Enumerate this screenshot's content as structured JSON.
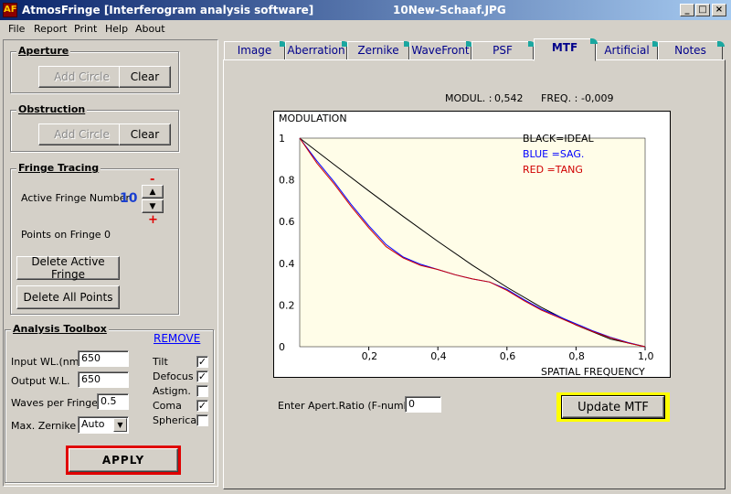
{
  "window": {
    "app_title": "AtmosFringe  [Interferogram analysis software]",
    "file_name": "10New-Schaaf.JPG",
    "icon_glyph": "AF",
    "controls": {
      "minimize": "_",
      "maximize": "□",
      "close": "×"
    }
  },
  "menu": [
    "File",
    "Report",
    "Print",
    "Help",
    "About"
  ],
  "aperture": {
    "title": "Aperture",
    "add_circle": "Add Circle",
    "clear": "Clear"
  },
  "obstruction": {
    "title": "Obstruction",
    "add_circle": "Add Circle",
    "clear": "Clear"
  },
  "fringe_tracing": {
    "title": "Fringe Tracing",
    "active_label": "Active Fringe Number",
    "active_value": "10",
    "minus": "-",
    "plus": "+",
    "points_label": "Points on  Fringe",
    "points_value": "0",
    "delete_active": "Delete Active Fringe",
    "delete_all": "Delete  All  Points"
  },
  "toolbox": {
    "title": "Analysis Toolbox",
    "remove": "REMOVE",
    "input_wl_label": "Input WL.(nm)",
    "input_wl_value": "650",
    "output_wl_label": "Output W.L.",
    "output_wl_value": "650",
    "waves_label": "Waves per Fringe",
    "waves_value": "0.5",
    "max_zernike_label": "Max. Zernike",
    "max_zernike_value": "Auto",
    "checks": [
      {
        "label": "Tilt",
        "checked": true
      },
      {
        "label": "Defocus",
        "checked": true
      },
      {
        "label": "Astigm.",
        "checked": false
      },
      {
        "label": "Coma",
        "checked": true
      },
      {
        "label": "Spherical",
        "checked": false
      }
    ],
    "apply": "APPLY"
  },
  "tabs": [
    "Image",
    "Aberration",
    "Zernike",
    "WaveFront",
    "PSF",
    "MTF",
    "Artificial",
    "Notes"
  ],
  "active_tab": "MTF",
  "mtf": {
    "modul_label": "MODUL. :",
    "modul_value": "0,542",
    "freq_label": "FREQ. :",
    "freq_value": "-0,009",
    "f_number_label": "Enter Apert.Ratio (F-number)",
    "f_number_value": "0",
    "update_button": "Update MTF"
  },
  "chart_data": {
    "type": "line",
    "ylabel": "MODULATION",
    "xlabel": "SPATIAL FREQUENCY",
    "xlim": [
      0,
      1
    ],
    "ylim": [
      0,
      1
    ],
    "x_ticks": [
      "0,2",
      "0,4",
      "0,6",
      "0,8",
      "1,0"
    ],
    "y_ticks": [
      "0",
      "0.2",
      "0.4",
      "0.6",
      "0.8",
      "1"
    ],
    "plot_background": "#fffde8",
    "legend": [
      "BLACK=IDEAL",
      "BLUE  =SAG.",
      "RED    =TANG"
    ],
    "series": [
      {
        "name": "IDEAL",
        "color": "#000000",
        "x": [
          0,
          0.1,
          0.2,
          0.3,
          0.4,
          0.5,
          0.6,
          0.7,
          0.8,
          0.9,
          1.0
        ],
        "y": [
          1.0,
          0.873,
          0.747,
          0.624,
          0.505,
          0.391,
          0.285,
          0.188,
          0.104,
          0.037,
          0.0
        ]
      },
      {
        "name": "SAG.",
        "color": "#0000ff",
        "x": [
          0,
          0.05,
          0.1,
          0.15,
          0.2,
          0.25,
          0.3,
          0.35,
          0.4,
          0.45,
          0.5,
          0.55,
          0.6,
          0.65,
          0.7,
          0.75,
          0.8,
          0.85,
          0.9,
          0.95,
          1.0
        ],
        "y": [
          1.0,
          0.89,
          0.79,
          0.68,
          0.58,
          0.49,
          0.43,
          0.395,
          0.37,
          0.345,
          0.325,
          0.31,
          0.275,
          0.225,
          0.18,
          0.145,
          0.11,
          0.075,
          0.045,
          0.02,
          0.0
        ]
      },
      {
        "name": "TANG",
        "color": "#d00000",
        "x": [
          0,
          0.05,
          0.1,
          0.15,
          0.2,
          0.25,
          0.3,
          0.35,
          0.4,
          0.45,
          0.5,
          0.55,
          0.6,
          0.65,
          0.7,
          0.75,
          0.8,
          0.85,
          0.9,
          0.95,
          1.0
        ],
        "y": [
          1.0,
          0.88,
          0.78,
          0.67,
          0.57,
          0.48,
          0.425,
          0.39,
          0.37,
          0.345,
          0.325,
          0.31,
          0.27,
          0.22,
          0.175,
          0.14,
          0.105,
          0.072,
          0.043,
          0.018,
          0.0
        ]
      }
    ]
  }
}
